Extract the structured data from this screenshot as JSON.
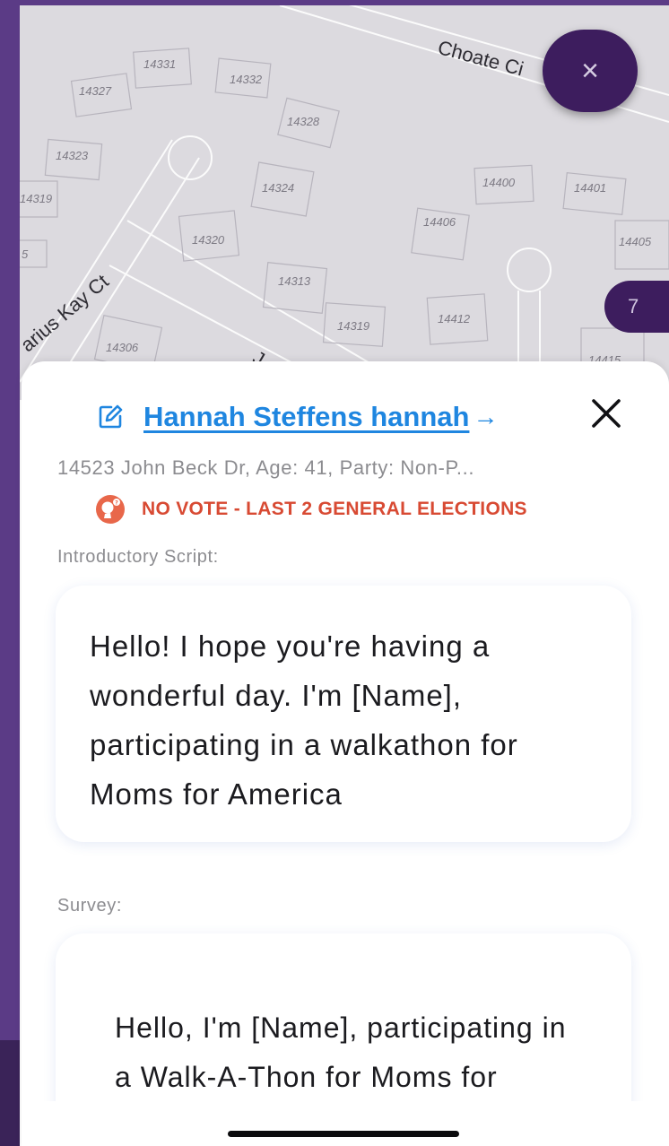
{
  "map": {
    "street_choate": "Choate Ci",
    "street_darius": "arius Kay Ct",
    "street_john": "J",
    "house_numbers": [
      "14331",
      "14332",
      "14327",
      "14328",
      "14323",
      "14324",
      "14319",
      "14320",
      "14400",
      "14401",
      "14406",
      "14405",
      "14313",
      "14319",
      "14412",
      "14306",
      "14415",
      "5"
    ],
    "close_fab_symbol": "×",
    "cluster_count": "7"
  },
  "voter": {
    "name": "Hannah Steffens hannah",
    "arrow": "→",
    "address_line": "14523 John Beck Dr, Age: 41, Party: Non-P...",
    "vote_status": "NO VOTE - LAST 2 GENERAL ELECTIONS"
  },
  "intro": {
    "label": "Introductory Script:",
    "text": "Hello! I hope you're having a wonderful day. I'm [Name], participating in a walkathon for Moms for America"
  },
  "survey": {
    "label": "Survey:",
    "text": "Hello, I'm [Name], participating in a Walk-A-Thon for Moms for"
  },
  "colors": {
    "purple_dark": "#3d1d5e",
    "link_blue": "#1f86e0",
    "alert_red": "#d84a33"
  },
  "icons": {
    "edit": "edit-icon",
    "close": "close-icon",
    "alert": "alert-icon",
    "arrow": "arrow-right-icon"
  }
}
